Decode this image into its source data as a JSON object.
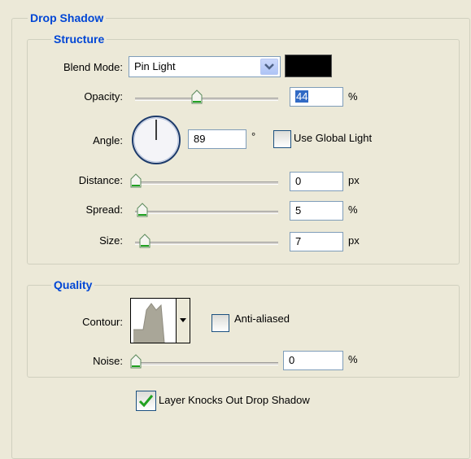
{
  "panel": {
    "title": "Drop Shadow",
    "structure": {
      "title": "Structure",
      "blend_mode_label": "Blend Mode:",
      "blend_mode_value": "Pin Light",
      "shadow_color": "#000000",
      "opacity_label": "Opacity:",
      "opacity_value": "44",
      "opacity_unit": "%",
      "opacity_level": 0.44,
      "angle_label": "Angle:",
      "angle_value": "89",
      "angle_unit": "°",
      "use_global_light_label": "Use Global Light",
      "use_global_light_checked": false,
      "distance_label": "Distance:",
      "distance_value": "0",
      "distance_unit": "px",
      "spread_label": "Spread:",
      "spread_value": "5",
      "spread_unit": "%",
      "size_label": "Size:",
      "size_value": "7",
      "size_unit": "px"
    },
    "quality": {
      "title": "Quality",
      "contour_label": "Contour:",
      "anti_aliased_label": "Anti-aliased",
      "anti_aliased_checked": false,
      "noise_label": "Noise:",
      "noise_value": "0",
      "noise_unit": "%"
    },
    "layer_knocks_out_label": "Layer Knocks Out Drop Shadow",
    "layer_knocks_out_checked": true
  },
  "colors": {
    "legend_text": "#0046d5",
    "field_border": "#7f9db9",
    "panel_bg": "#ece9d8",
    "check_green": "#21a121",
    "dropdown_arrow": "#4d6185"
  }
}
